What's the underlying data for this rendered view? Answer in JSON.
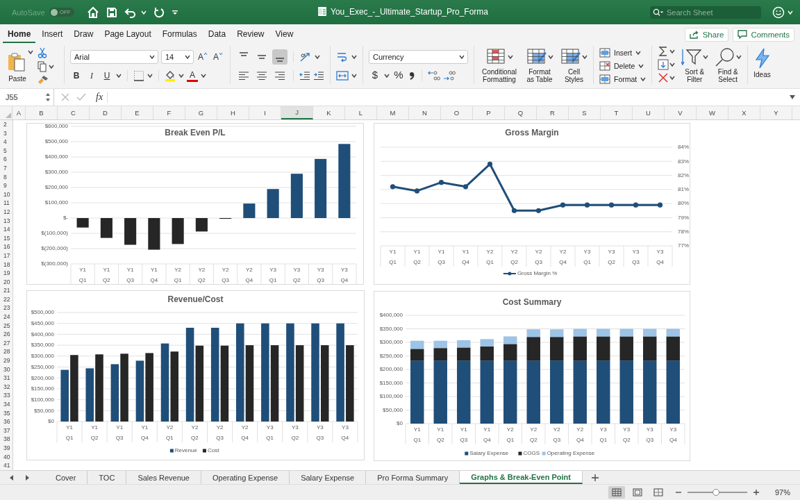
{
  "title_bar": {
    "autosave_label": "AutoSave",
    "autosave_toggle": {
      "label": "OFF",
      "on": false
    },
    "file_title": "You_Exec_-_Ultimate_Startup_Pro_Forma",
    "search": {
      "placeholder": "Search Sheet"
    }
  },
  "ribbon_tabs": [
    {
      "label": "Home",
      "selected": true
    },
    {
      "label": "Insert",
      "selected": false
    },
    {
      "label": "Draw",
      "selected": false
    },
    {
      "label": "Page Layout",
      "selected": false
    },
    {
      "label": "Formulas",
      "selected": false
    },
    {
      "label": "Data",
      "selected": false
    },
    {
      "label": "Review",
      "selected": false
    },
    {
      "label": "View",
      "selected": false
    }
  ],
  "share_button": "Share",
  "comments_button": "Comments",
  "ribbon": {
    "paste": "Paste",
    "font": {
      "family": "Arial",
      "size": "14",
      "grow_label": "A",
      "shrink_label": "A",
      "bold": "B",
      "italic": "I",
      "underline": "U",
      "color_buttons": [
        {
          "kind": "fill",
          "color": "#ffee00"
        },
        {
          "kind": "font",
          "label": "A",
          "color": "#e00000"
        }
      ]
    },
    "alignment": [
      {
        "kind": "top",
        "selected": false
      },
      {
        "kind": "middle",
        "selected": false
      },
      {
        "kind": "bottom",
        "selected": true
      },
      {
        "kind": "left",
        "selected": false
      },
      {
        "kind": "center",
        "selected": false
      },
      {
        "kind": "right",
        "selected": false
      }
    ],
    "number": {
      "format": "Currency",
      "currency": "$",
      "percent": "%"
    },
    "styles": [
      "Conditional Formatting",
      "Format as Table",
      "Cell Styles"
    ],
    "cells": [
      "Insert",
      "Delete",
      "Format"
    ],
    "editing": [
      "Sort & Filter",
      "Find & Select"
    ],
    "ideas": "Ideas"
  },
  "formula_bar": {
    "name_box": "J55",
    "fx": "fx"
  },
  "columns": [
    {
      "label": "A",
      "selected": false
    },
    {
      "label": "B",
      "selected": false
    },
    {
      "label": "C",
      "selected": false
    },
    {
      "label": "D",
      "selected": false
    },
    {
      "label": "E",
      "selected": false
    },
    {
      "label": "F",
      "selected": false
    },
    {
      "label": "G",
      "selected": false
    },
    {
      "label": "H",
      "selected": false
    },
    {
      "label": "I",
      "selected": false
    },
    {
      "label": "J",
      "selected": true
    },
    {
      "label": "K",
      "selected": false
    },
    {
      "label": "L",
      "selected": false
    },
    {
      "label": "M",
      "selected": false
    },
    {
      "label": "N",
      "selected": false
    },
    {
      "label": "O",
      "selected": false
    },
    {
      "label": "P",
      "selected": false
    },
    {
      "label": "Q",
      "selected": false
    },
    {
      "label": "R",
      "selected": false
    },
    {
      "label": "S",
      "selected": false
    },
    {
      "label": "T",
      "selected": false
    },
    {
      "label": "U",
      "selected": false
    },
    {
      "label": "V",
      "selected": false
    },
    {
      "label": "W",
      "selected": false
    },
    {
      "label": "X",
      "selected": false
    },
    {
      "label": "Y",
      "selected": false
    }
  ],
  "rows": [
    "2",
    "3",
    "4",
    "5",
    "6",
    "7",
    "8",
    "9",
    "10",
    "11",
    "12",
    "13",
    "14",
    "15",
    "16",
    "17",
    "18",
    "19",
    "20",
    "21",
    "22",
    "23",
    "24",
    "25",
    "26",
    "27",
    "28",
    "29",
    "30",
    "31",
    "32",
    "33",
    "34",
    "35",
    "36",
    "37",
    "38",
    "39",
    "40",
    "41"
  ],
  "charts": [
    {
      "chart_data": {
        "type": "bar",
        "stacked": true,
        "grid": true,
        "title": "Break Even P/L",
        "categories": [
          "Y1 Q1",
          "Y1 Q2",
          "Y1 Q3",
          "Y1 Q4",
          "Y2 Q1",
          "Y2 Q2",
          "Y2 Q3",
          "Y2 Q4",
          "Y3 Q1",
          "Y3 Q2",
          "Y3 Q3",
          "Y3 Q4"
        ],
        "ylim": [
          -300000,
          600000
        ],
        "yticks": [
          {
            "value": -300000,
            "label": "$(300,000)"
          },
          {
            "value": -200000,
            "label": "$(200,000)"
          },
          {
            "value": -100000,
            "label": "$(100,000)"
          },
          {
            "value": 0,
            "label": "$-"
          },
          {
            "value": 100000,
            "label": "$100,000"
          },
          {
            "value": 200000,
            "label": "$200,000"
          },
          {
            "value": 300000,
            "label": "$300,000"
          },
          {
            "value": 400000,
            "label": "$400,000"
          },
          {
            "value": 500000,
            "label": "$500,000"
          },
          {
            "value": 600000,
            "label": "$600,000"
          }
        ],
        "series": [
          {
            "color": "#262626",
            "values": [
              -62000,
              -130000,
              -175000,
              -207000,
              -170000,
              -88000,
              -5000,
              null,
              null,
              null,
              null,
              null
            ]
          },
          {
            "color": "#1f4e79",
            "values": [
              null,
              null,
              null,
              null,
              null,
              null,
              null,
              95000,
              190000,
              290000,
              387000,
              485000
            ]
          }
        ]
      }
    },
    {
      "chart_data": {
        "type": "line",
        "grid": true,
        "legend": "bottom",
        "title": "Gross Margin",
        "categories": [
          "Y1 Q1",
          "Y1 Q2",
          "Y1 Q3",
          "Y1 Q4",
          "Y2 Q1",
          "Y2 Q2",
          "Y2 Q3",
          "Y2 Q4",
          "Y3 Q1",
          "Y3 Q2",
          "Y3 Q3",
          "Y3 Q4"
        ],
        "ylim": [
          77,
          84
        ],
        "yticks": [
          {
            "value": 77,
            "label": "77%"
          },
          {
            "value": 78,
            "label": "78%"
          },
          {
            "value": 79,
            "label": "79%"
          },
          {
            "value": 80,
            "label": "80%"
          },
          {
            "value": 81,
            "label": "81%"
          },
          {
            "value": 82,
            "label": "82%"
          },
          {
            "value": 83,
            "label": "83%"
          },
          {
            "value": 84,
            "label": "84%"
          }
        ],
        "series": [
          {
            "name": "Gross Margin %",
            "color": "#1f4e79",
            "marker": "circle",
            "values": [
              81.2,
              80.9,
              81.5,
              81.2,
              82.8,
              79.5,
              79.5,
              79.9,
              79.9,
              79.9,
              79.9,
              79.9
            ]
          }
        ]
      }
    },
    {
      "chart_data": {
        "type": "bar",
        "grid": true,
        "legend": "bottom",
        "title": "Revenue/Cost",
        "categories": [
          "Y1 Q1",
          "Y1 Q2",
          "Y1 Q3",
          "Y1 Q4",
          "Y2 Q1",
          "Y2 Q2",
          "Y2 Q3",
          "Y2 Q4",
          "Y3 Q1",
          "Y3 Q2",
          "Y3 Q3",
          "Y3 Q4"
        ],
        "ylim": [
          0,
          500000
        ],
        "yticks": [
          {
            "value": 0,
            "label": "$0"
          },
          {
            "value": 50000,
            "label": "$50,000"
          },
          {
            "value": 100000,
            "label": "$100,000"
          },
          {
            "value": 150000,
            "label": "$150,000"
          },
          {
            "value": 200000,
            "label": "$200,000"
          },
          {
            "value": 250000,
            "label": "$250,000"
          },
          {
            "value": 300000,
            "label": "$300,000"
          },
          {
            "value": 350000,
            "label": "$350,000"
          },
          {
            "value": 400000,
            "label": "$400,000"
          },
          {
            "value": 450000,
            "label": "$450,000"
          },
          {
            "value": 500000,
            "label": "$500,000"
          }
        ],
        "series": [
          {
            "name": "Revenue",
            "color": "#1f4e79",
            "values": [
              237000,
              244000,
              263000,
              279000,
              358000,
              430000,
              430000,
              450000,
              450000,
              450000,
              450000,
              450000
            ]
          },
          {
            "name": "Cost",
            "color": "#262626",
            "values": [
              305000,
              308000,
              311000,
              314000,
              321000,
              348000,
              348000,
              350000,
              350000,
              350000,
              350000,
              350000
            ]
          }
        ]
      }
    },
    {
      "chart_data": {
        "type": "bar",
        "stacked": true,
        "grid": true,
        "legend": "bottom",
        "title": "Cost Summary",
        "categories": [
          "Y1 Q1",
          "Y1 Q2",
          "Y1 Q3",
          "Y1 Q4",
          "Y2 Q1",
          "Y2 Q2",
          "Y2 Q3",
          "Y2 Q4",
          "Y3 Q1",
          "Y3 Q2",
          "Y3 Q3",
          "Y3 Q4"
        ],
        "ylim": [
          0,
          400000
        ],
        "yticks": [
          {
            "value": 0,
            "label": "$0"
          },
          {
            "value": 50000,
            "label": "$50,000"
          },
          {
            "value": 100000,
            "label": "$100,000"
          },
          {
            "value": 150000,
            "label": "$150,000"
          },
          {
            "value": 200000,
            "label": "$200,000"
          },
          {
            "value": 250000,
            "label": "$250,000"
          },
          {
            "value": 300000,
            "label": "$300,000"
          },
          {
            "value": 350000,
            "label": "$350,000"
          },
          {
            "value": 400000,
            "label": "$400,000"
          }
        ],
        "series": [
          {
            "name": "Salary Expense",
            "color": "#1f4e79",
            "values": [
              233000,
              233000,
              233000,
              233000,
              233000,
              233000,
              233000,
              233000,
              233000,
              233000,
              233000,
              233000
            ]
          },
          {
            "name": "COGS",
            "color": "#262626",
            "values": [
              43000,
              46000,
              48000,
              52000,
              61000,
              87000,
              87000,
              89000,
              89000,
              89000,
              89000,
              89000
            ]
          },
          {
            "name": "Operating Expense",
            "color": "#9dc3e6",
            "values": [
              30000,
              27000,
              27000,
              27000,
              28000,
              28000,
              28000,
              28000,
              28000,
              28000,
              28000,
              28000
            ]
          }
        ]
      }
    }
  ],
  "sheet_tabs": [
    {
      "label": "Cover",
      "selected": false
    },
    {
      "label": "TOC",
      "selected": false
    },
    {
      "label": "Sales Revenue",
      "selected": false
    },
    {
      "label": "Operating Expense",
      "selected": false
    },
    {
      "label": "Salary Expense",
      "selected": false
    },
    {
      "label": "Pro Forma Summary",
      "selected": false
    },
    {
      "label": "Graphs & Break-Even Point",
      "selected": true
    }
  ],
  "status_bar": {
    "views": [
      {
        "kind": "normal",
        "selected": true
      },
      {
        "kind": "page_layout",
        "selected": false
      },
      {
        "kind": "page_break",
        "selected": false
      }
    ],
    "zoom": {
      "level": 0.48,
      "reading": "97%"
    }
  }
}
